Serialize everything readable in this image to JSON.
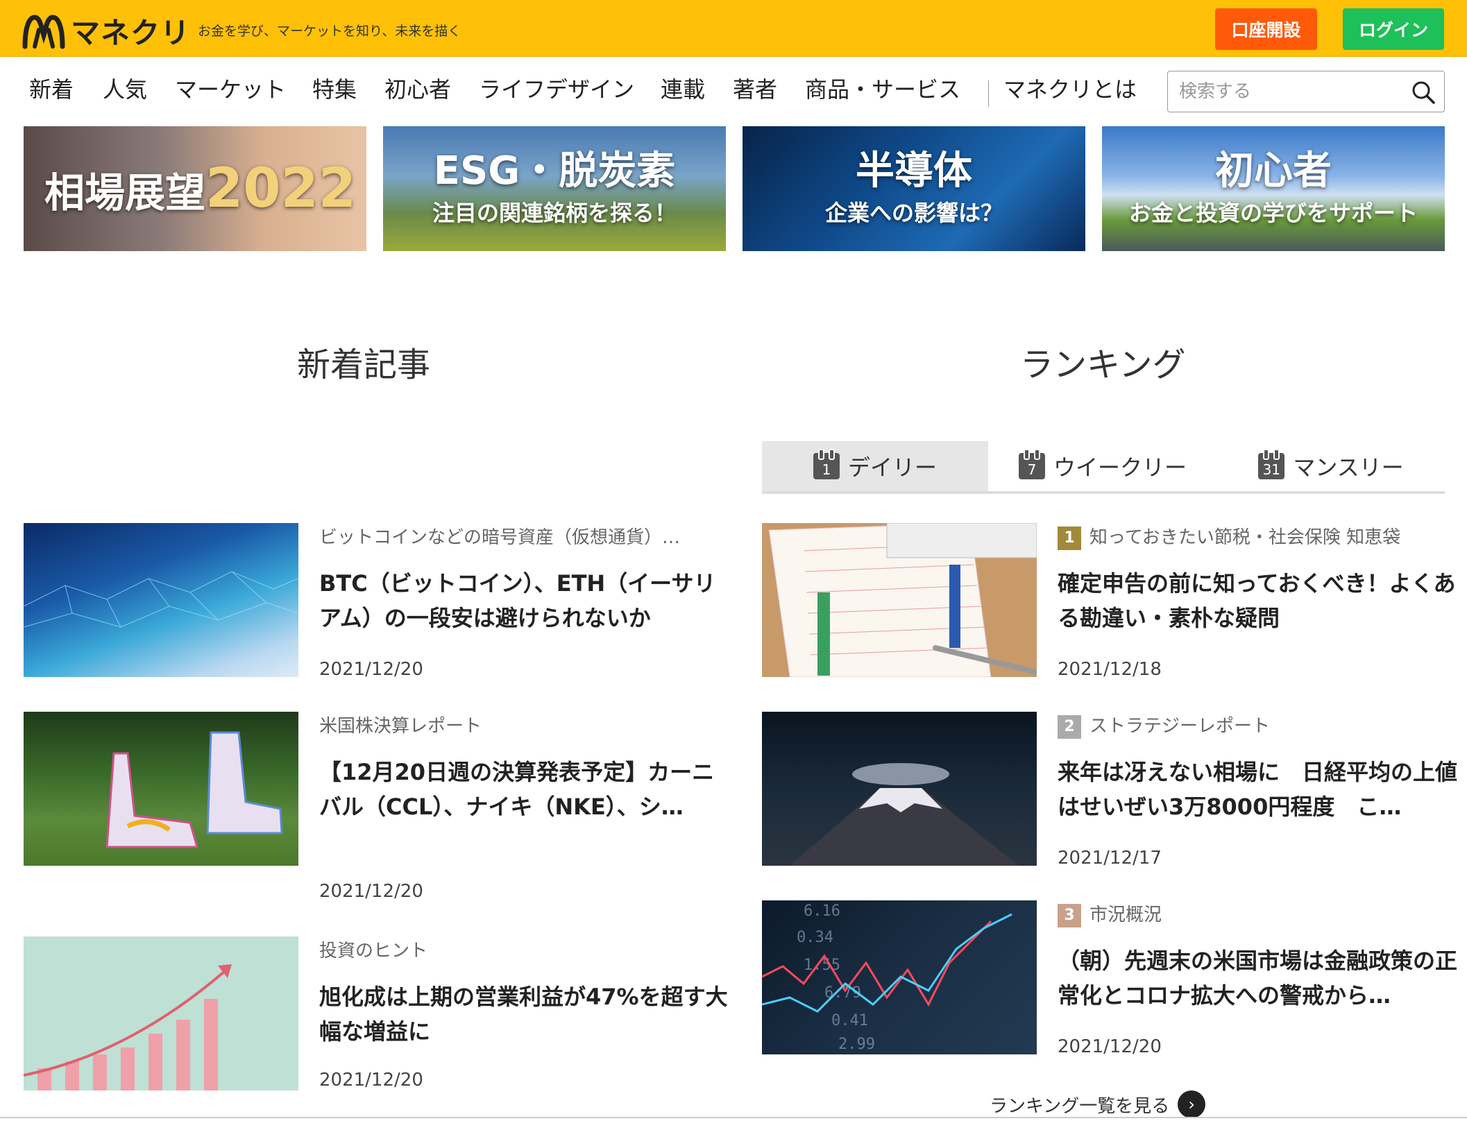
{
  "header": {
    "logo_text": "マネクリ",
    "tagline": "お金を学び、マーケットを知り、未来を描く",
    "open_account_label": "口座開設",
    "login_label": "ログイン"
  },
  "nav": {
    "items": [
      "新着",
      "人気",
      "マーケット",
      "特集",
      "初心者",
      "ライフデザイン",
      "連載",
      "著者",
      "商品・サービス",
      "マネクリとは"
    ],
    "search_placeholder": "検索する"
  },
  "banners": [
    {
      "title": "相場展望",
      "year": "2022"
    },
    {
      "title": "ESG・脱炭素",
      "sub": "注目の関連銘柄を探る！"
    },
    {
      "title": "半導体",
      "sub": "企業への影響は？"
    },
    {
      "title": "初心者",
      "sub": "お金と投資の学びをサポート"
    }
  ],
  "sections": {
    "new_articles": "新着記事",
    "ranking": "ランキング"
  },
  "ranking_tabs": [
    {
      "label": "デイリー",
      "cal": "1"
    },
    {
      "label": "ウイークリー",
      "cal": "7"
    },
    {
      "label": "マンスリー",
      "cal": "31"
    }
  ],
  "new_articles": [
    {
      "category": "ビットコインなどの暗号資産（仮想通貨）…",
      "title": "BTC（ビットコイン）、ETH（イーサリアム）の一段安は避けられないか",
      "date": "2021/12/20"
    },
    {
      "category": "米国株決算レポート",
      "title": "【12月20日週の決算発表予定】カーニバル（CCL）、ナイキ（NKE）、シ…",
      "date": "2021/12/20"
    },
    {
      "category": "投資のヒント",
      "title": "旭化成は上期の営業利益が47%を超す大幅な増益に",
      "date": "2021/12/20"
    }
  ],
  "ranking_articles": [
    {
      "rank": "1",
      "category": "知っておきたい節税・社会保険 知恵袋",
      "title": "確定申告の前に知っておくべき！よくある勘違い・素朴な疑問",
      "date": "2021/12/18"
    },
    {
      "rank": "2",
      "category": "ストラテジーレポート",
      "title": "来年は冴えない相場に　日経平均の上値はせいぜい3万8000円程度　こ…",
      "date": "2021/12/17"
    },
    {
      "rank": "3",
      "category": "市況概況",
      "title": "（朝）先週末の米国市場は金融政策の正常化とコロナ拡大への警戒から…",
      "date": "2021/12/20"
    }
  ],
  "ranking_more": "ランキング一覧を見る"
}
